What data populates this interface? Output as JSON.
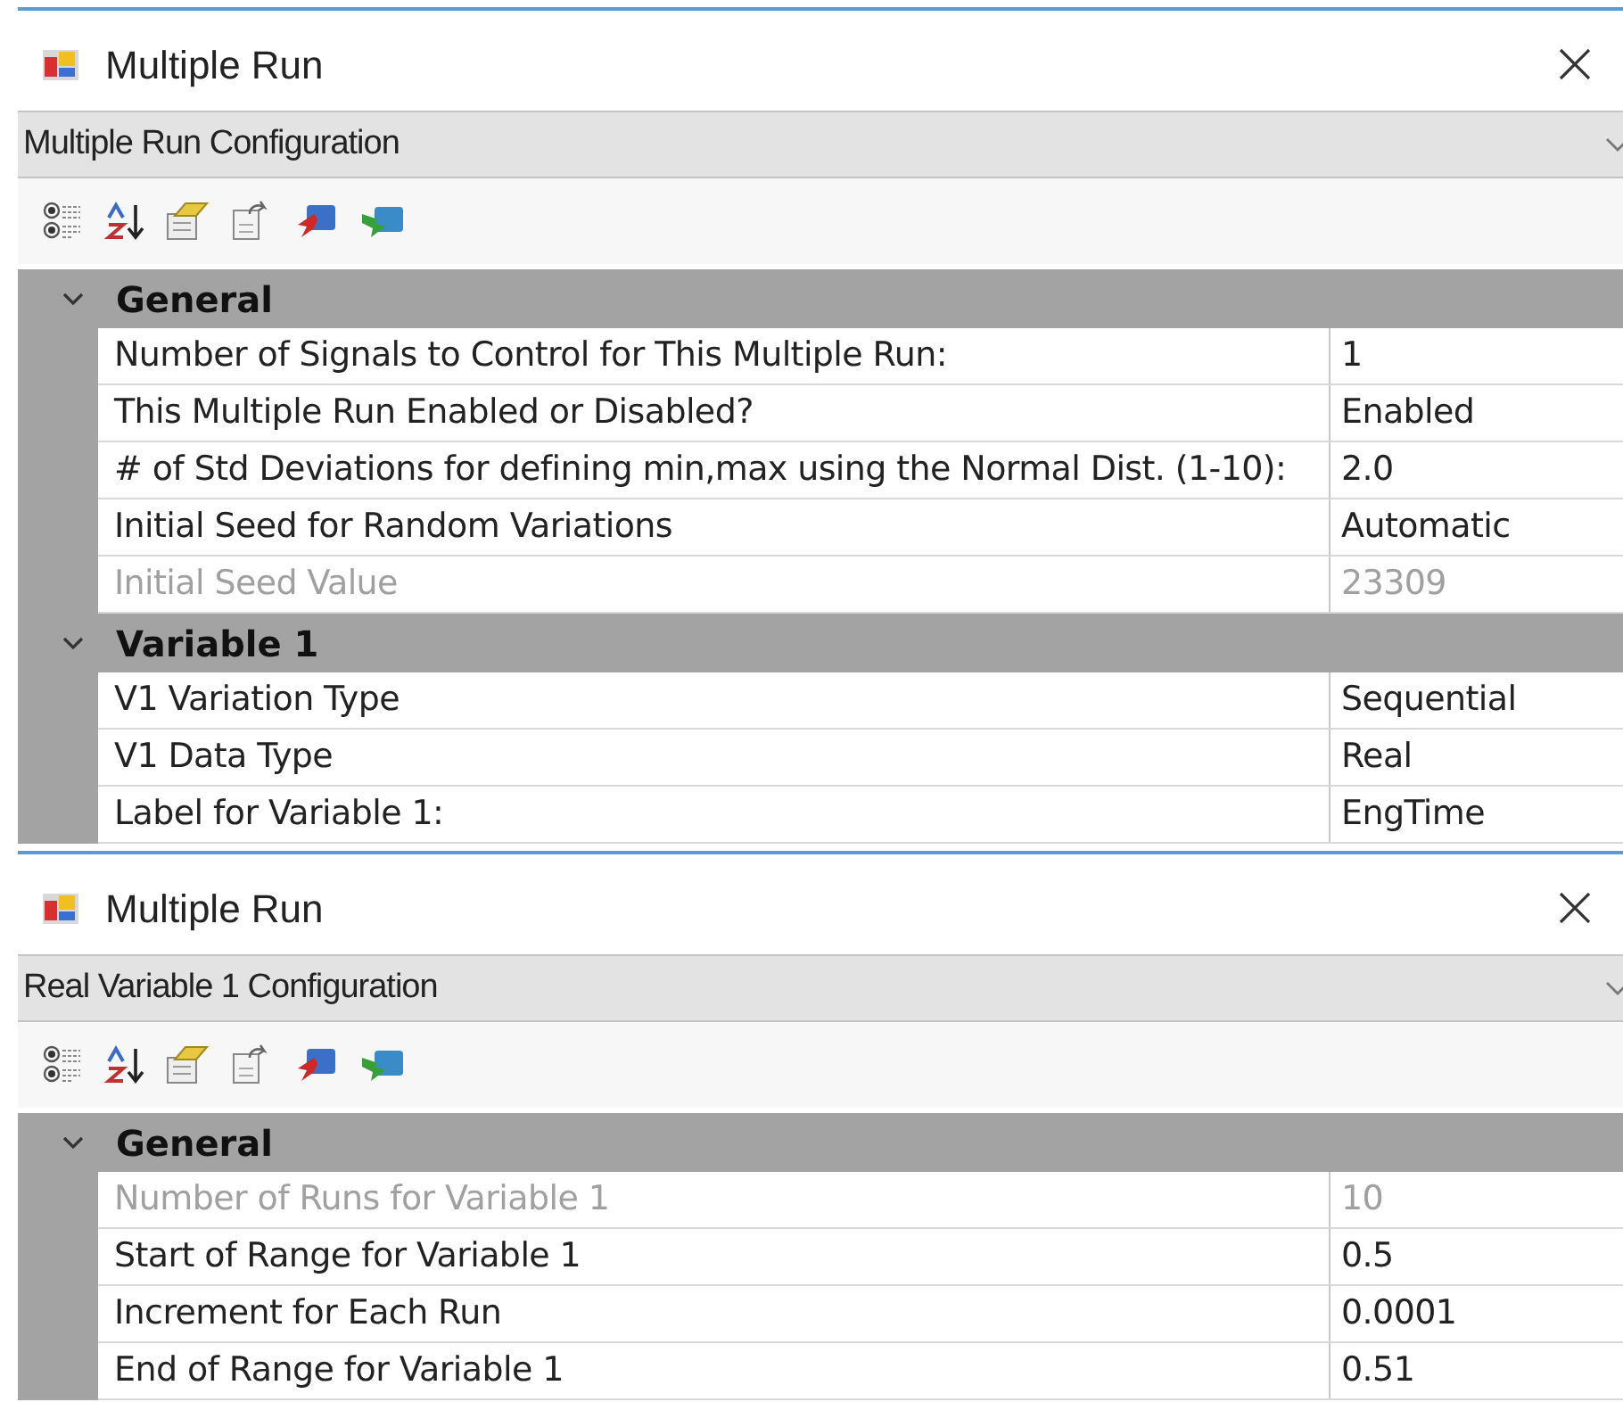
{
  "panels": [
    {
      "window": {
        "title": "Multiple Run"
      },
      "config": {
        "title": "Multiple Run Configuration"
      },
      "sections": [
        {
          "title": "General",
          "expanded": true,
          "rows": [
            {
              "label": "Number of Signals to Control for This Multiple Run:",
              "value": "1",
              "disabled": false
            },
            {
              "label": "This Multiple Run Enabled or Disabled?",
              "value": "Enabled",
              "disabled": false
            },
            {
              "label": "# of Std Deviations for defining min,max using the Normal Dist. (1-10):",
              "value": "2.0",
              "disabled": false
            },
            {
              "label": "Initial Seed for Random Variations",
              "value": "Automatic",
              "disabled": false
            },
            {
              "label": "Initial Seed Value",
              "value": "23309",
              "disabled": true
            }
          ]
        },
        {
          "title": "Variable 1",
          "expanded": true,
          "rows": [
            {
              "label": "V1 Variation Type",
              "value": "Sequential",
              "disabled": false
            },
            {
              "label": "V1 Data Type",
              "value": "Real",
              "disabled": false
            },
            {
              "label": "Label for Variable 1:",
              "value": "EngTime",
              "disabled": false
            }
          ]
        }
      ]
    },
    {
      "window": {
        "title": "Multiple Run"
      },
      "config": {
        "title": "Real Variable 1 Configuration"
      },
      "sections": [
        {
          "title": "General",
          "expanded": true,
          "rows": [
            {
              "label": "Number of Runs for Variable 1",
              "value": "10",
              "disabled": true
            },
            {
              "label": "Start of Range for Variable 1",
              "value": "0.5",
              "disabled": false
            },
            {
              "label": "Increment for Each Run",
              "value": "0.0001",
              "disabled": false
            },
            {
              "label": "End of Range for Variable 1",
              "value": "0.51",
              "disabled": false
            }
          ]
        }
      ]
    }
  ]
}
